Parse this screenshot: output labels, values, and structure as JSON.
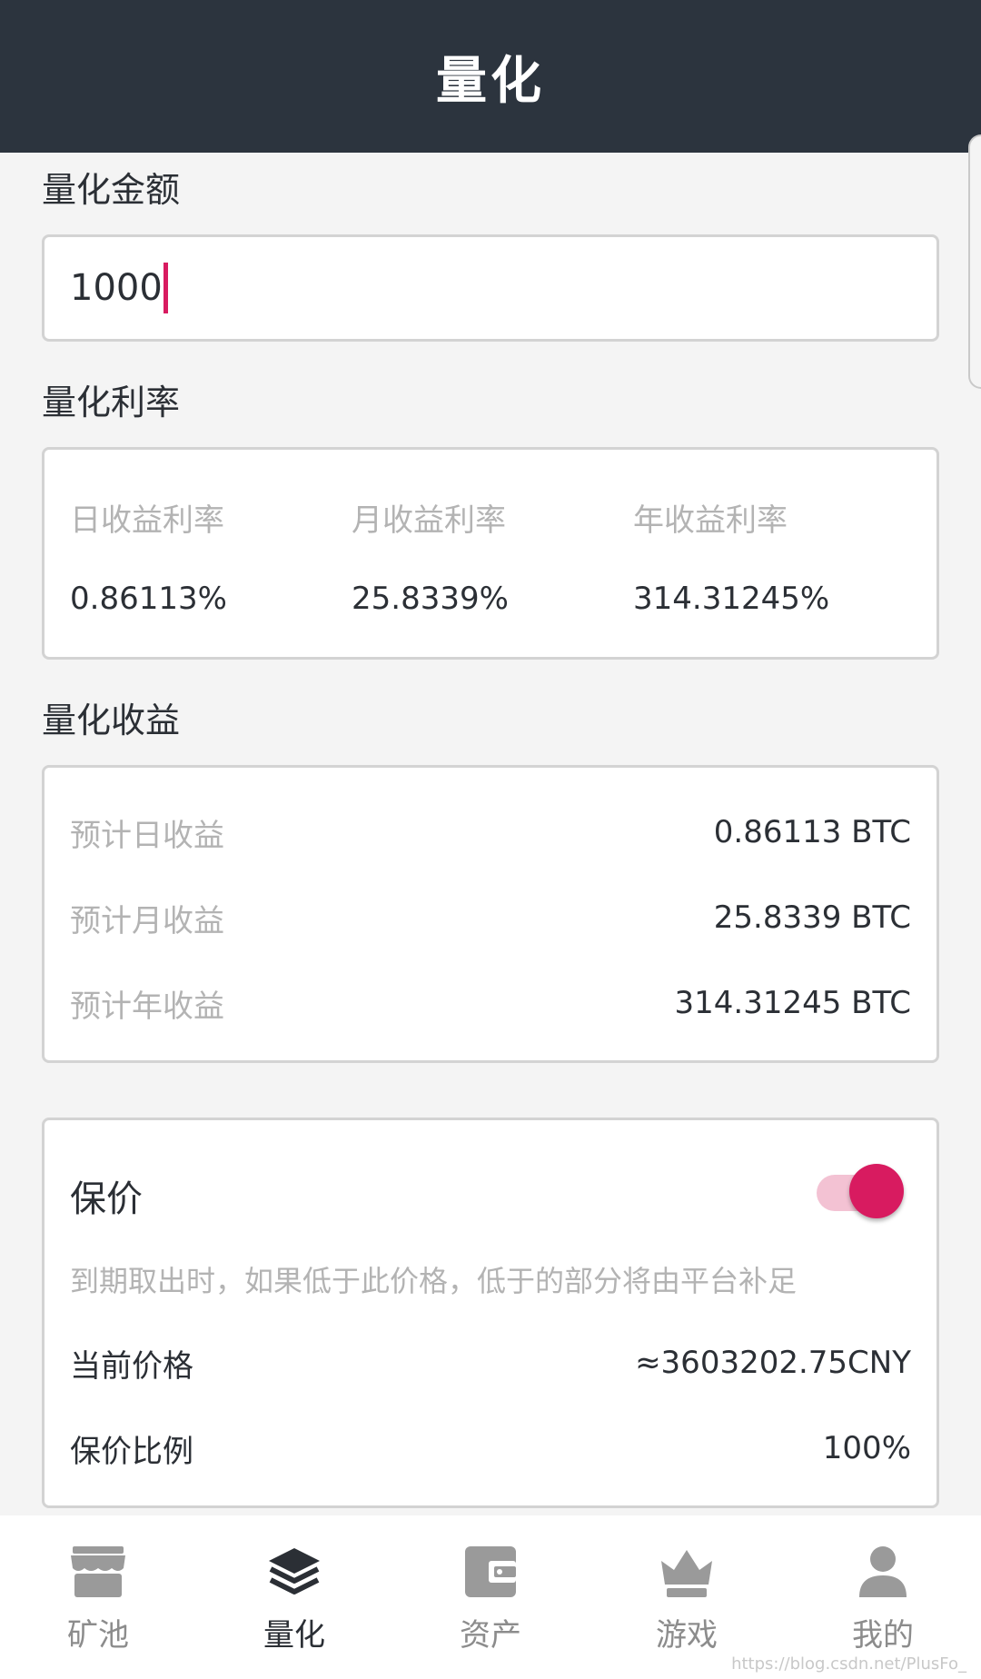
{
  "header": {
    "title": "量化"
  },
  "amount": {
    "label": "量化金额",
    "value": "1000"
  },
  "rates": {
    "label": "量化利率",
    "items": [
      {
        "label": "日收益利率",
        "value": "0.86113%"
      },
      {
        "label": "月收益利率",
        "value": "25.8339%"
      },
      {
        "label": "年收益利率",
        "value": "314.31245%"
      }
    ]
  },
  "income": {
    "label": "量化收益",
    "rows": [
      {
        "label": "预计日收益",
        "value": "0.86113 BTC"
      },
      {
        "label": "预计月收益",
        "value": "25.8339 BTC"
      },
      {
        "label": "预计年收益",
        "value": "314.31245 BTC"
      }
    ]
  },
  "protection": {
    "title": "保价",
    "enabled": true,
    "description": "到期取出时，如果低于此价格，低于的部分将由平台补足",
    "rows": [
      {
        "label": "当前价格",
        "value": "≈3603202.75CNY"
      },
      {
        "label": "保价比例",
        "value": "100%"
      }
    ]
  },
  "tabbar": {
    "tabs": [
      {
        "label": "矿池",
        "icon": "store-icon",
        "active": false
      },
      {
        "label": "量化",
        "icon": "layers-icon",
        "active": true
      },
      {
        "label": "资产",
        "icon": "wallet-icon",
        "active": false
      },
      {
        "label": "游戏",
        "icon": "crown-icon",
        "active": false
      },
      {
        "label": "我的",
        "icon": "user-icon",
        "active": false
      }
    ]
  },
  "watermark": "https://blog.csdn.net/PlusFo_",
  "colors": {
    "header": "#2c343e",
    "accent": "#d81b60",
    "background": "#f4f4f4"
  }
}
